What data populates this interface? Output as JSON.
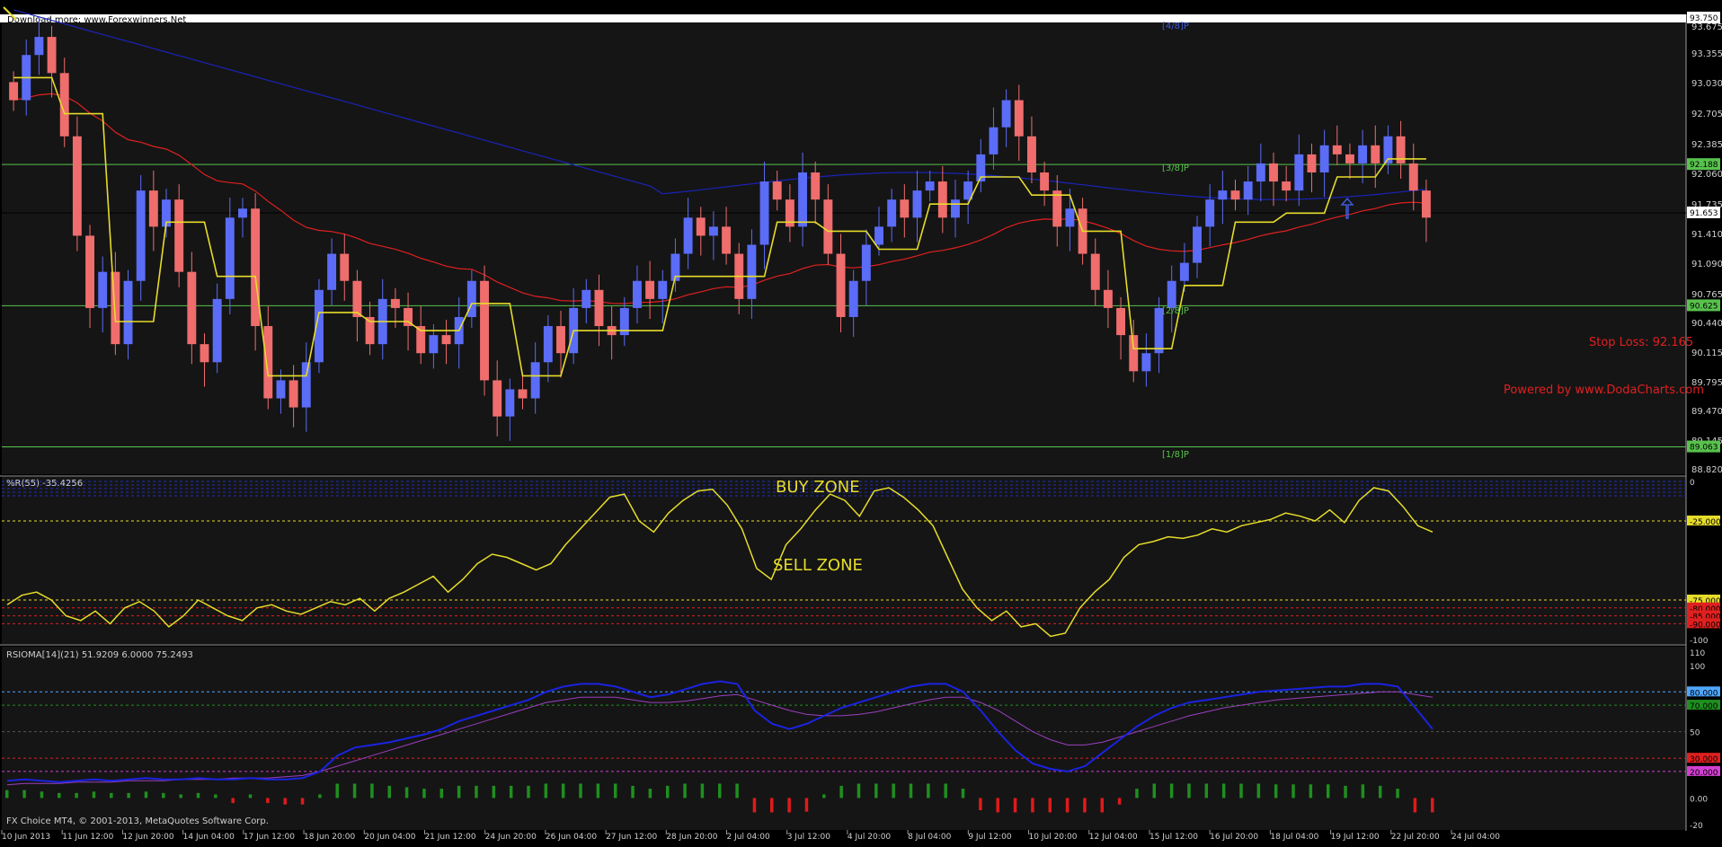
{
  "colors": {
    "background": "#000000",
    "panel": "#151515",
    "bull_candle": "#5b6cf7",
    "bear_candle": "#ef6d6d",
    "signal_line": "#e6dc2a",
    "ma_red": "#e02020",
    "ma_blue": "#1a23b8",
    "murrey_green": "#58c24d",
    "rsioma_blue": "#1a23e0",
    "rsioma_signal": "#9b3fbf",
    "hist_green": "#1f8f1f",
    "hist_red": "#e01a1a"
  },
  "main": {
    "top_text": "Download more: www.Forexwinners.Net",
    "price_ticks": [
      "93.675",
      "93.355",
      "93.030",
      "92.705",
      "92.385",
      "92.060",
      "91.735",
      "91.410",
      "91.090",
      "90.765",
      "90.440",
      "90.115",
      "89.795",
      "89.470",
      "89.145",
      "88.820"
    ],
    "labels": {
      "current_price": "91.653",
      "top_right_tag": "93.750",
      "line_38_value": "92.188",
      "line_28_value": "90.625",
      "line_18_value": "89.063",
      "murrey_48": "[4/8]P",
      "murrey_38": "[3/8]P",
      "murrey_28": "[2/8]P",
      "murrey_18": "[1/8]P",
      "stop_loss": "Stop Loss: 92.165",
      "powered_by": "Powered by www.DodaCharts.com"
    }
  },
  "wpr": {
    "title": "%R(55) -35.4256",
    "buy_zone": "BUY ZONE",
    "sell_zone": "SELL ZONE",
    "ticks": [
      "0",
      "-25.000",
      "-75.000",
      "-80.000",
      "-85.000",
      "-90.000",
      "-100"
    ]
  },
  "rsioma": {
    "title": "RSIOMA[14](21) 51.9209 6.0000 75.2493",
    "ticks": [
      "110",
      "100",
      "80.000",
      "70.000",
      "50",
      "30.000",
      "20.000",
      "0.00",
      "-20"
    ]
  },
  "footer": {
    "copyright": "FX Choice MT4, © 2001-2013, MetaQuotes Software Corp.",
    "time_labels": [
      "10 Jun 2013",
      "11 Jun 12:00",
      "12 Jun 20:00",
      "14 Jun 04:00",
      "17 Jun 12:00",
      "18 Jun 20:00",
      "20 Jun 04:00",
      "21 Jun 12:00",
      "24 Jun 20:00",
      "26 Jun 04:00",
      "27 Jun 12:00",
      "28 Jun 20:00",
      "2 Jul 04:00",
      "3 Jul 12:00",
      "4 Jul 20:00",
      "8 Jul 04:00",
      "9 Jul 12:00",
      "10 Jul 20:00",
      "12 Jul 04:00",
      "15 Jul 12:00",
      "16 Jul 20:00",
      "18 Jul 04:00",
      "19 Jul 12:00",
      "22 Jul 20:00",
      "24 Jul 04:00"
    ]
  },
  "chart_data": [
    {
      "type": "candlestick",
      "title": "",
      "ylim": [
        88.82,
        93.75
      ],
      "levels": [
        92.188,
        90.625,
        89.063
      ],
      "current_price": 91.653,
      "close": [
        92.9,
        93.4,
        93.6,
        93.2,
        92.5,
        91.4,
        90.6,
        91.0,
        90.2,
        90.9,
        91.9,
        91.5,
        91.8,
        91.0,
        90.2,
        90.0,
        90.7,
        91.6,
        91.7,
        90.4,
        89.6,
        89.8,
        89.5,
        90.0,
        90.8,
        91.2,
        90.9,
        90.5,
        90.2,
        90.7,
        90.6,
        90.4,
        90.1,
        90.3,
        90.2,
        90.5,
        90.9,
        89.8,
        89.4,
        89.7,
        89.6,
        90.0,
        90.4,
        90.1,
        90.6,
        90.8,
        90.4,
        90.3,
        90.6,
        90.9,
        90.7,
        90.9,
        91.2,
        91.6,
        91.4,
        91.5,
        91.2,
        90.7,
        91.3,
        92.0,
        91.8,
        91.5,
        92.1,
        91.8,
        91.2,
        90.5,
        90.9,
        91.3,
        91.5,
        91.8,
        91.6,
        91.9,
        92.0,
        91.6,
        91.8,
        92.0,
        92.3,
        92.6,
        92.9,
        92.5,
        92.1,
        91.9,
        91.5,
        91.7,
        91.2,
        90.8,
        90.6,
        90.3,
        89.9,
        90.1,
        90.6,
        90.9,
        91.1,
        91.5,
        91.8,
        91.9,
        91.8,
        92.0,
        92.2,
        92.0,
        91.9,
        92.3,
        92.1,
        92.4,
        92.3,
        92.2,
        92.4,
        92.2,
        92.5,
        92.2,
        91.9,
        91.6
      ]
    },
    {
      "type": "line",
      "title": "%R(55) -35.4256",
      "ylim": [
        -100,
        0
      ],
      "levels": [
        -25,
        -75,
        -80,
        -85,
        -90
      ],
      "values": [
        -78,
        -72,
        -70,
        -75,
        -85,
        -88,
        -82,
        -90,
        -80,
        -76,
        -82,
        -92,
        -85,
        -75,
        -80,
        -85,
        -88,
        -80,
        -78,
        -82,
        -84,
        -80,
        -76,
        -78,
        -74,
        -82,
        -74,
        -70,
        -65,
        -60,
        -70,
        -62,
        -52,
        -46,
        -48,
        -52,
        -56,
        -52,
        -40,
        -30,
        -20,
        -10,
        -8,
        -25,
        -32,
        -20,
        -12,
        -6,
        -5,
        -15,
        -30,
        -55,
        -62,
        -40,
        -30,
        -18,
        -8,
        -12,
        -22,
        -6,
        -4,
        -10,
        -18,
        -28,
        -48,
        -68,
        -80,
        -88,
        -82,
        -92,
        -90,
        -98,
        -96,
        -80,
        -70,
        -62,
        -48,
        -40,
        -38,
        -35,
        -36,
        -34,
        -30,
        -32,
        -28,
        -26,
        -24,
        -20,
        -22,
        -25,
        -18,
        -26,
        -12,
        -4,
        -6,
        -16,
        -28,
        -32
      ]
    },
    {
      "type": "line",
      "title": "RSIOMA[14](21) 51.9209 6.0000 75.2493",
      "ylim": [
        -20,
        110
      ],
      "levels": [
        80,
        70,
        30,
        20
      ],
      "series": [
        {
          "values": [
            13,
            14,
            13,
            12,
            13,
            14,
            13,
            14,
            15,
            14,
            14,
            15,
            14,
            14,
            15,
            14,
            14,
            15,
            20,
            32,
            38,
            40,
            42,
            45,
            48,
            52,
            58,
            62,
            66,
            70,
            74,
            80,
            84,
            86,
            86,
            84,
            80,
            76,
            78,
            82,
            86,
            88,
            86,
            66,
            56,
            52,
            56,
            62,
            68,
            72,
            76,
            80,
            84,
            86,
            86,
            80,
            66,
            50,
            36,
            26,
            22,
            20,
            24,
            34,
            44,
            54,
            62,
            68,
            72,
            74,
            76,
            78,
            80,
            81,
            82,
            83,
            84,
            84,
            86,
            86,
            84,
            68,
            52
          ]
        },
        {
          "values": [
            10,
            11,
            11,
            11,
            12,
            12,
            12,
            13,
            13,
            13,
            14,
            14,
            14,
            15,
            15,
            15,
            16,
            17,
            20,
            24,
            28,
            32,
            36,
            40,
            44,
            48,
            52,
            56,
            60,
            64,
            68,
            72,
            74,
            76,
            76,
            76,
            74,
            72,
            72,
            73,
            75,
            77,
            78,
            74,
            70,
            66,
            63,
            62,
            62,
            63,
            65,
            68,
            71,
            74,
            76,
            76,
            72,
            66,
            58,
            50,
            44,
            40,
            40,
            42,
            46,
            50,
            54,
            58,
            62,
            65,
            68,
            70,
            72,
            74,
            75,
            76,
            77,
            78,
            79,
            80,
            80,
            78,
            76
          ]
        }
      ]
    }
  ]
}
